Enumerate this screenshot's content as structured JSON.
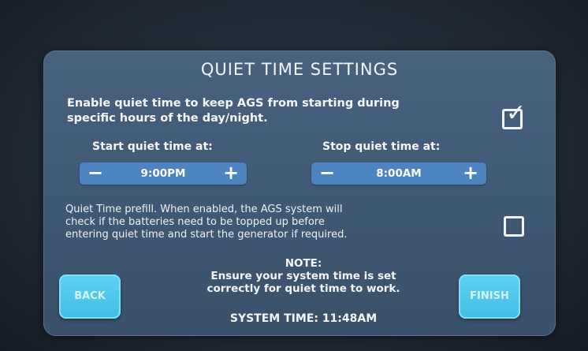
{
  "title": "QUIET TIME SETTINGS",
  "enable": {
    "line1": "Enable quiet time to keep AGS from starting during",
    "line2": "specific hours of the day/night.",
    "checked": true
  },
  "start": {
    "label": "Start quiet time at:",
    "minus": "−",
    "value": "9:00PM",
    "plus": "+"
  },
  "stop": {
    "label": "Stop quiet time at:",
    "minus": "−",
    "value": "8:00AM",
    "plus": "+"
  },
  "prefill": {
    "line1": "Quiet Time prefill. When enabled, the AGS system will",
    "line2": "check if the batteries need to be topped up before",
    "line3": "entering quiet time and start the generator if required.",
    "checked": false
  },
  "note": {
    "heading": "NOTE:",
    "line1": "Ensure your system time is set",
    "line2": "correctly for quiet time to work."
  },
  "system_time": "SYSTEM TIME: 11:48AM",
  "buttons": {
    "back": "BACK",
    "finish": "FINISH"
  },
  "colors": {
    "panel": "#46607c",
    "stepper": "#4c84c2",
    "action_button": "#4fc6ec"
  }
}
